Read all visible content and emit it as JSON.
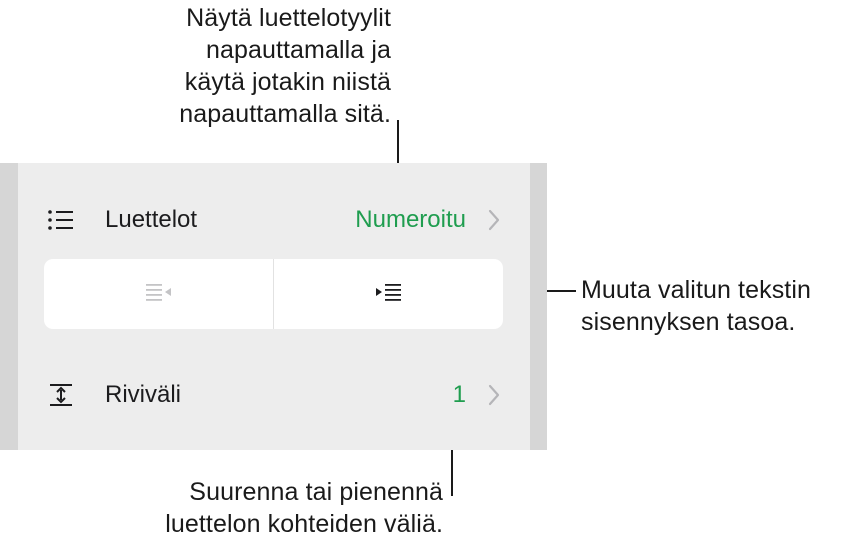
{
  "callouts": {
    "top": [
      "Näytä luettelotyylit",
      "napauttamalla ja",
      "käytä jotakin niistä",
      "napauttamalla sitä."
    ],
    "right": [
      "Muuta valitun tekstin",
      "sisennyksen tasoa."
    ],
    "bottom": [
      "Suurenna tai pienennä",
      "luettelon kohteiden väliä."
    ]
  },
  "lists_row": {
    "label": "Luettelot",
    "value": "Numeroitu",
    "icon": "list-bullets-icon"
  },
  "indent_control": {
    "decrease_icon": "outdent-icon",
    "increase_icon": "indent-icon",
    "decrease_enabled": false,
    "increase_enabled": true
  },
  "spacing_row": {
    "label": "Riviväli",
    "value": "1",
    "icon": "line-spacing-icon"
  },
  "colors": {
    "accent": "#1f9d4f",
    "panel": "#ededed",
    "text": "#1c1c1e"
  }
}
